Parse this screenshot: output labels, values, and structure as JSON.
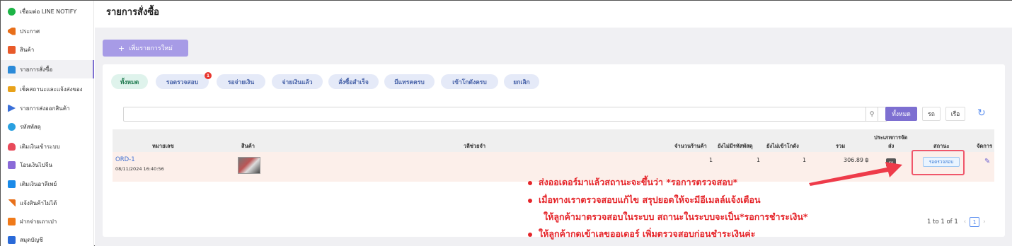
{
  "sidebar": {
    "items": [
      {
        "label": "เชื่อมต่อ LINE NOTIFY",
        "icon": "line-icon",
        "color": "#1db446"
      },
      {
        "label": "ประกาศ",
        "icon": "megaphone-icon",
        "color": "#e86f1a"
      },
      {
        "label": "สินค้า",
        "icon": "box-icon",
        "color": "#e85a2a"
      },
      {
        "label": "รายการสั่งซื้อ",
        "icon": "cart-icon",
        "color": "#2b8ad8"
      },
      {
        "label": "เช็คสถานะและแจ้งส่งของ",
        "icon": "truck-icon",
        "color": "#e8a21a"
      },
      {
        "label": "รายการส่งออกสินค้า",
        "icon": "export-icon",
        "color": "#3a6fd8"
      },
      {
        "label": "รหัสพัสดุ",
        "icon": "parcel-icon",
        "color": "#2aa0e0"
      },
      {
        "label": "เติมเงินเข้าระบบ",
        "icon": "wallet-icon",
        "color": "#e84a5a"
      },
      {
        "label": "โอนเงินไปจีน",
        "icon": "transfer-icon",
        "color": "#8a6ad8"
      },
      {
        "label": "เติมเงินอาลีเพย์",
        "icon": "alipay-icon",
        "color": "#1a8ae8"
      },
      {
        "label": "แจ้งสินค้าไม่ได้",
        "icon": "report-icon",
        "color": "#e8701a"
      },
      {
        "label": "ฝากจ่ายเถาเปา",
        "icon": "taobao-icon",
        "color": "#f07a1a"
      },
      {
        "label": "สมุดบัญชี",
        "icon": "book-icon",
        "color": "#2a6ad8"
      }
    ],
    "active_index": 3
  },
  "header": {
    "title": "รายการสั่งซื้อ"
  },
  "toolbar": {
    "add_label": "เพิ่มรายการใหม่",
    "add_icon": "plus-icon"
  },
  "tabs": [
    {
      "label": "ทั้งหมด",
      "active": true
    },
    {
      "label": "รอตรวจสอบ",
      "badge": "1"
    },
    {
      "label": "รอจ่ายเงิน"
    },
    {
      "label": "จ่ายเงินแล้ว"
    },
    {
      "label": "สั่งซื้อสำเร็จ"
    },
    {
      "label": "มีแทรคครบ"
    },
    {
      "label": "เข้าโกดังครบ"
    },
    {
      "label": "ยกเลิก"
    }
  ],
  "search": {
    "placeholder": "",
    "filters": [
      "ทั้งหมด",
      "รถ",
      "เรือ"
    ],
    "active_filter": 0
  },
  "table": {
    "headers": [
      "หมายเลข",
      "สินค้า",
      "วลีช่วยจำ",
      "จำนวนร้านค้า",
      "ยังไม่มีรหัสพัสดุ",
      "ยังไม่เข้าโกดัง",
      "รวม",
      "ประเภทการจัด",
      "ส่ง",
      "สถานะ",
      "จัดการ"
    ],
    "rows": [
      {
        "order_no": "ORD-1",
        "datetime": "08/11/2024 16:40:56",
        "shops": "1",
        "no_tracking": "1",
        "not_in_warehouse": "1",
        "total": "306.89 ฿",
        "shipping_type": "รถ",
        "status": "รอตรวจสอบ"
      }
    ]
  },
  "pagination": {
    "summary": "1 to 1 of 1",
    "page": "1",
    "prev": "‹",
    "next": "›"
  },
  "annotations": [
    "ส่งออเดอร์มาแล้วสถานะจะขึ้นว่า *รอการตรวจสอบ*",
    "เมื่อทางเราตรวจสอบแก้ไข สรุปยอดให้จะมีอีเมลล์แจ้งเตือน",
    "ให้ลูกค้ามาตรวจสอบในระบบ สถานะในระบบจะเป็น*รอการชำระเงิน*",
    "ให้ลูกค้ากดเข้าเลขออเดอร์ เพิ่มตรวจสอบก่อนชำระเงินค่ะ"
  ],
  "colors": {
    "accent": "#7d6fd1",
    "annotation": "#e5252a",
    "status_border": "#f0566a"
  }
}
